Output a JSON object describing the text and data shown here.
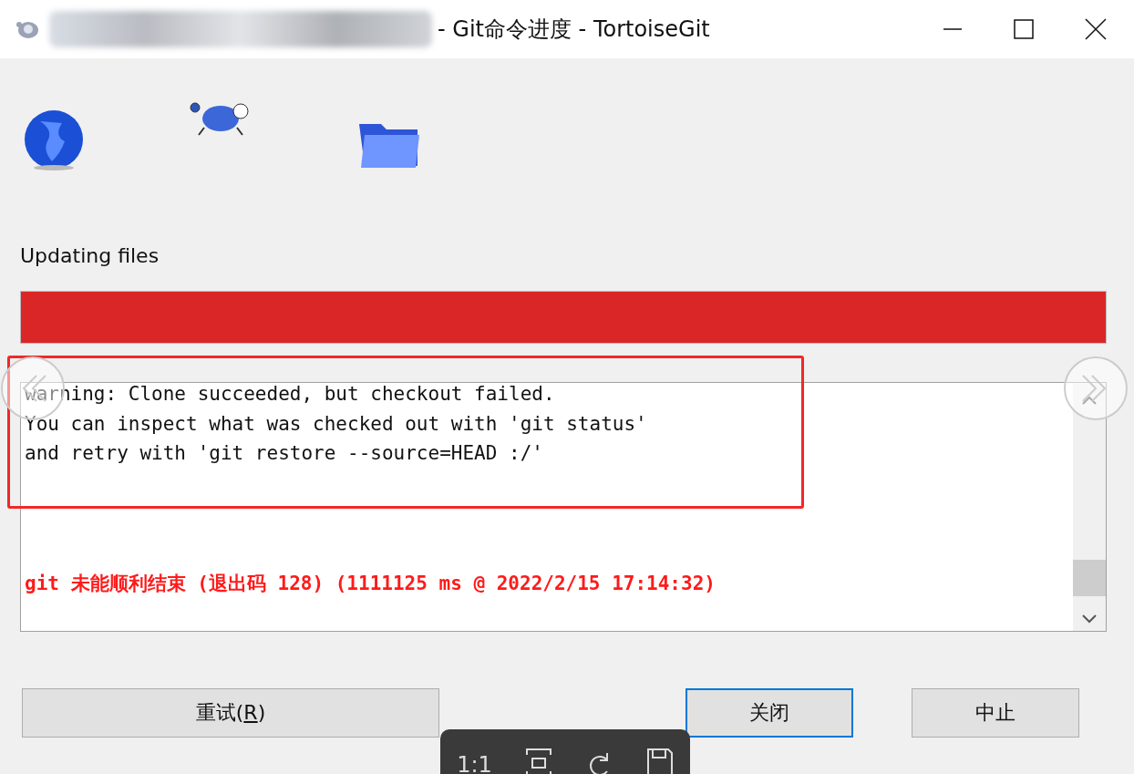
{
  "window": {
    "title": "- Git命令进度 - TortoiseGit",
    "title_redacted": true
  },
  "status_text": "Updating files",
  "progress": {
    "level": 1
  },
  "log": [
    {
      "text": "warning: Clone succeeded, but checkout failed.",
      "kind": "normal"
    },
    {
      "text": "You can inspect what was checked out with 'git status'",
      "kind": "normal"
    },
    {
      "text": "and retry with 'git restore --source=HEAD :/'",
      "kind": "normal"
    },
    {
      "kind": "gap"
    },
    {
      "text": "git 未能顺利结束 (退出码 128) (1111125 ms @ 2022/2/15 17:14:32)",
      "kind": "error"
    }
  ],
  "buttons": [
    {
      "before": "重试(",
      "accel": "R",
      "after": ")",
      "focused": false,
      "wide": true
    },
    {
      "before": "关闭",
      "focused": true,
      "wide": false
    },
    {
      "before": "中止",
      "focused": false,
      "wide": false
    }
  ],
  "viewer_toolbar": {
    "zoom_label": "1:1"
  }
}
